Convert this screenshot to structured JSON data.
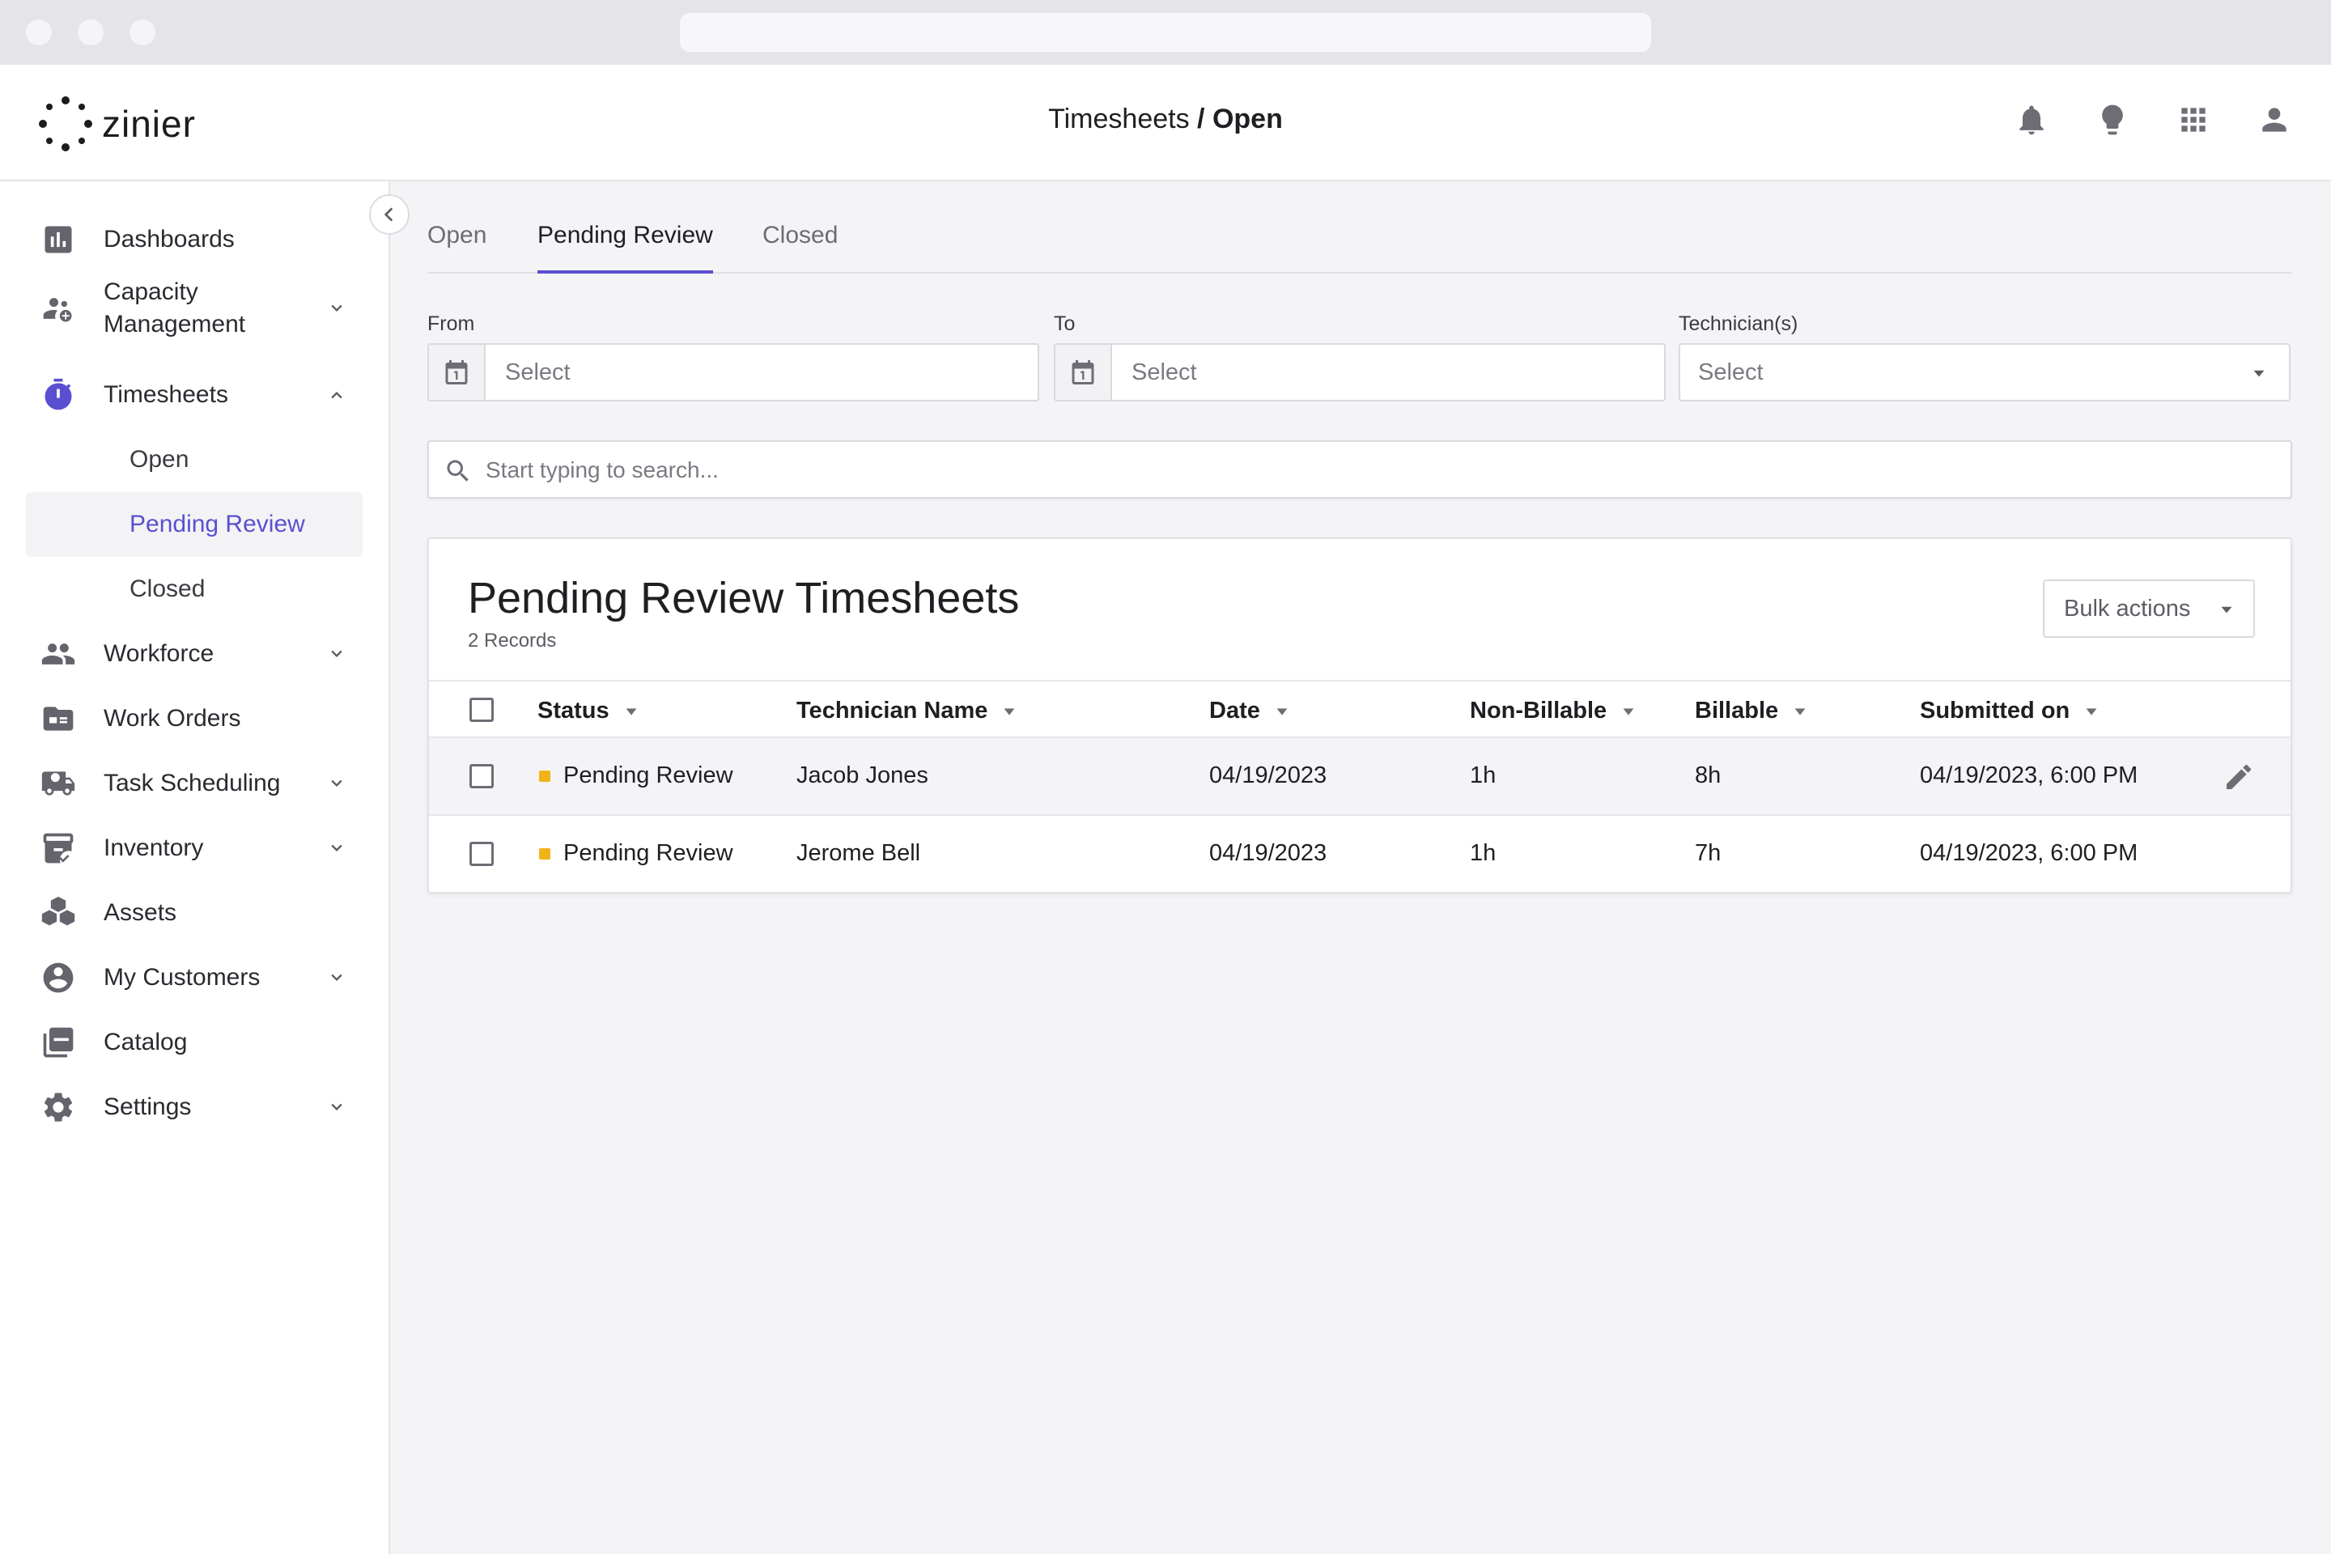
{
  "header": {
    "logo_text": "zinier",
    "title_prefix": "Timesheets",
    "title_sep": "/",
    "title_current": "Open",
    "icons": [
      "bell-icon",
      "lightbulb-icon",
      "apps-grid-icon",
      "user-icon"
    ]
  },
  "sidebar": {
    "items": [
      {
        "label": "Dashboards",
        "icon": "chart-icon"
      },
      {
        "label": "Capacity Management",
        "icon": "people-settings-icon"
      },
      {
        "label": "Timesheets",
        "icon": "stopwatch-icon"
      },
      {
        "label": "Workforce",
        "icon": "group-icon"
      },
      {
        "label": "Work Orders",
        "icon": "folder-card-icon"
      },
      {
        "label": "Task Scheduling",
        "icon": "truck-clock-icon"
      },
      {
        "label": "Inventory",
        "icon": "box-check-icon"
      },
      {
        "label": "Assets",
        "icon": "cubes-icon"
      },
      {
        "label": "My Customers",
        "icon": "account-circle-icon"
      },
      {
        "label": "Catalog",
        "icon": "book-icon"
      },
      {
        "label": "Settings",
        "icon": "gear-icon"
      }
    ],
    "sub_items": [
      {
        "label": "Open"
      },
      {
        "label": "Pending Review"
      },
      {
        "label": "Closed"
      }
    ]
  },
  "tabs": [
    {
      "label": "Open"
    },
    {
      "label": "Pending Review"
    },
    {
      "label": "Closed"
    }
  ],
  "filters": {
    "from_label": "From",
    "from_value": "Select",
    "to_label": "To",
    "to_value": "Select",
    "tech_label": "Technician(s)",
    "tech_value": "Select"
  },
  "search": {
    "placeholder": "Start typing to search..."
  },
  "table": {
    "title": "Pending Review Timesheets",
    "records": "2 Records",
    "bulk_label": "Bulk actions",
    "columns": [
      "Status",
      "Technician Name",
      "Date",
      "Non-Billable",
      "Billable",
      "Submitted on"
    ],
    "rows": [
      {
        "status": "Pending Review",
        "technician": "Jacob Jones",
        "date": "04/19/2023",
        "non_billable": "1h",
        "billable": "8h",
        "submitted": "04/19/2023, 6:00 PM"
      },
      {
        "status": "Pending Review",
        "technician": "Jerome Bell",
        "date": "04/19/2023",
        "non_billable": "1h",
        "billable": "7h",
        "submitted": "04/19/2023, 6:00 PM"
      }
    ]
  },
  "colors": {
    "accent": "#5b4fd1",
    "status_pending": "#f2b31a",
    "icon_gray": "#64646d"
  }
}
